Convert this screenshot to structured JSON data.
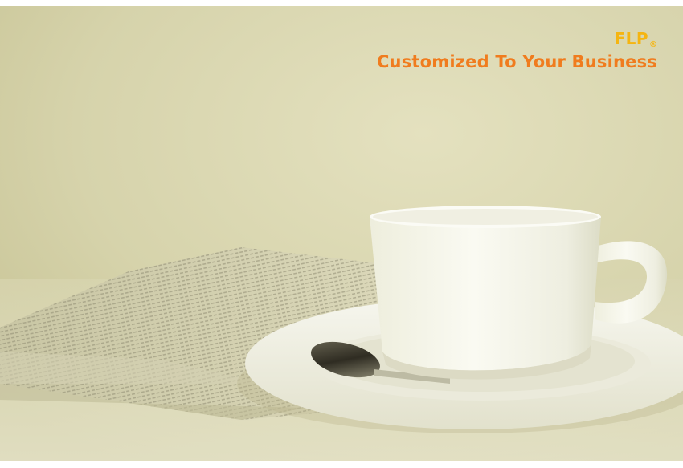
{
  "brand": {
    "name": "FLP",
    "registered_mark": "®",
    "tagline": "Customized To Your Business"
  },
  "colors": {
    "brand_name": "#f5b511",
    "tagline": "#f07c1e",
    "background_light": "#dedbb6",
    "background_dark": "#c9c595",
    "cup": "#f4f4ea"
  },
  "photo": {
    "subject": "coffee-cup-saucer-spoon-newspaper"
  }
}
